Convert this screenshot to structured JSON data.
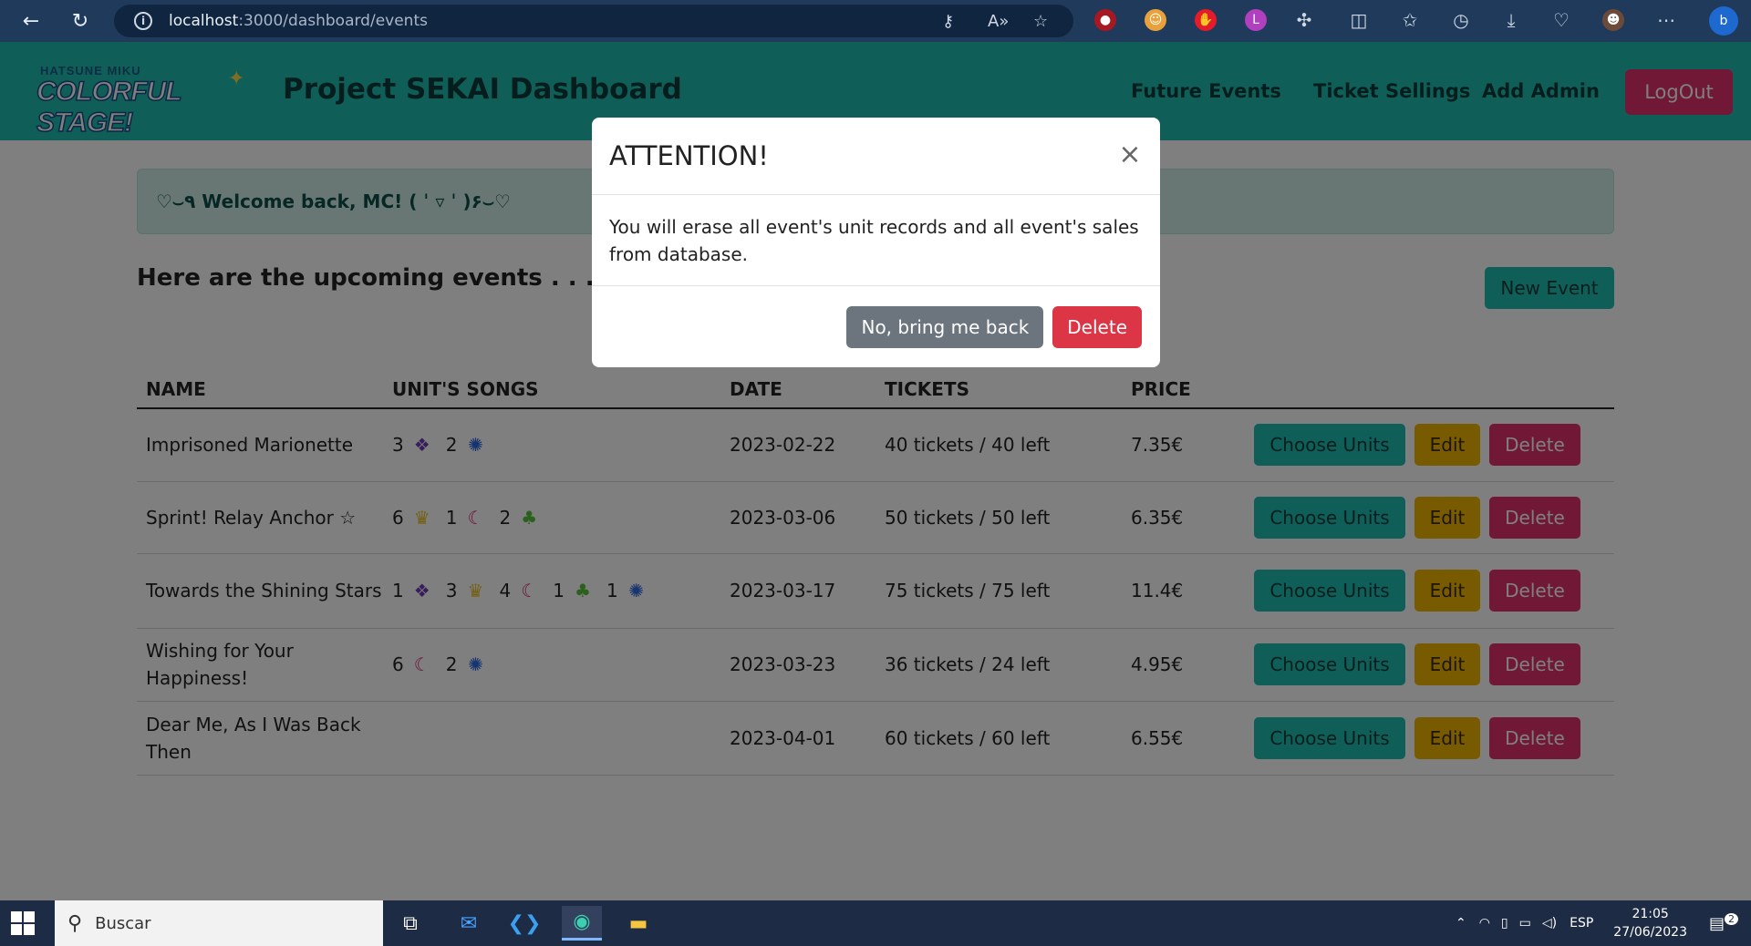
{
  "browser": {
    "url_host": "localhost",
    "url_path": ":3000/dashboard/events"
  },
  "navbar": {
    "logo_small": "HATSUNE MIKU",
    "logo_big": "COLORFUL STAGE!",
    "brand": "Project SEKAI Dashboard",
    "links": [
      "Future Events",
      "Ticket Sellings",
      "Add Admin"
    ],
    "logout": "LogOut"
  },
  "welcome": "♡⌣٩ Welcome back, MC! ( ˈ ▿ ˈ )۶⌣♡",
  "events_heading": "Here are the upcoming events . . .",
  "new_event": "New Event",
  "table": {
    "headers": [
      "NAME",
      "UNIT'S SONGS",
      "DATE",
      "TICKETS",
      "PRICE"
    ],
    "rows": [
      {
        "name": "Imprisoned Marionette",
        "songs": [
          {
            "count": "3",
            "unit": "Leo/need"
          },
          {
            "count": "2",
            "unit": "Nightcord"
          }
        ],
        "date": "2023-02-22",
        "tickets": "40 tickets / 40 left",
        "price": "7.35€"
      },
      {
        "name": "Sprint! Relay Anchor ☆",
        "songs": [
          {
            "count": "6",
            "unit": "MORE MORE JUMP!"
          },
          {
            "count": "1",
            "unit": "Vivid BAD SQUAD"
          },
          {
            "count": "2",
            "unit": "Wonderlands×Showtime"
          }
        ],
        "date": "2023-03-06",
        "tickets": "50 tickets / 50 left",
        "price": "6.35€"
      },
      {
        "name": "Towards the Shining Stars",
        "songs": [
          {
            "count": "1",
            "unit": "Leo/need"
          },
          {
            "count": "3",
            "unit": "MORE MORE JUMP!"
          },
          {
            "count": "4",
            "unit": "Vivid BAD SQUAD"
          },
          {
            "count": "1",
            "unit": "Wonderlands×Showtime"
          },
          {
            "count": "1",
            "unit": "Nightcord"
          }
        ],
        "date": "2023-03-17",
        "tickets": "75 tickets / 75 left",
        "price": "11.4€"
      },
      {
        "name": "Wishing for Your Happiness!",
        "songs": [
          {
            "count": "6",
            "unit": "Vivid BAD SQUAD"
          },
          {
            "count": "2",
            "unit": "Nightcord"
          }
        ],
        "date": "2023-03-23",
        "tickets": "36 tickets / 24 left",
        "price": "4.95€"
      },
      {
        "name": "Dear Me, As I Was Back Then",
        "songs": [],
        "date": "2023-04-01",
        "tickets": "60 tickets / 60 left",
        "price": "6.55€"
      }
    ],
    "choose_units_label": "Choose Units",
    "edit_label": "Edit",
    "delete_label": "Delete"
  },
  "modal": {
    "title": "ATTENTION!",
    "body": "You will erase all event's unit records and all event's sales from database.",
    "cancel": "No, bring me back",
    "confirm": "Delete"
  },
  "taskbar": {
    "search_placeholder": "Buscar",
    "language": "ESP",
    "time": "21:05",
    "date": "27/06/2023",
    "notification_count": "2"
  },
  "colors": {
    "accent": "#1fbfb0",
    "danger": "#e1306c",
    "warning": "#f0b400"
  }
}
